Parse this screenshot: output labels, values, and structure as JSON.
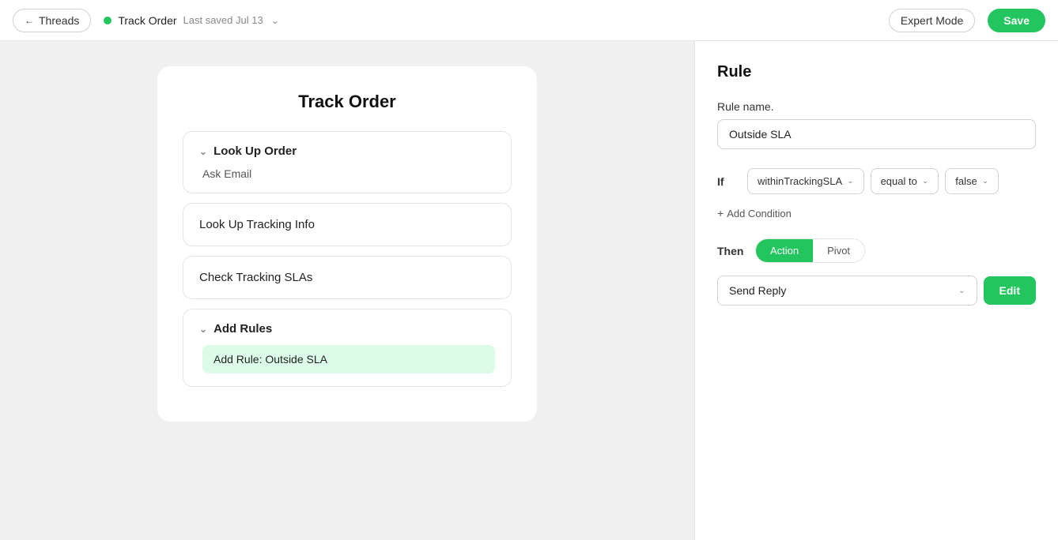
{
  "topbar": {
    "threads_label": "Threads",
    "track_order_label": "Track Order",
    "saved_label": "Last saved Jul 13",
    "expert_mode_label": "Expert Mode",
    "save_label": "Save"
  },
  "flow": {
    "title": "Track Order",
    "blocks": [
      {
        "id": "look-up-order",
        "label": "Look Up Order",
        "collapsible": true,
        "expanded": true,
        "content": "Ask Email"
      },
      {
        "id": "look-up-tracking-info",
        "label": "Look Up Tracking Info",
        "collapsible": false,
        "expanded": false,
        "content": null
      },
      {
        "id": "check-tracking-slas",
        "label": "Check Tracking SLAs",
        "collapsible": false,
        "expanded": false,
        "content": null
      },
      {
        "id": "add-rules",
        "label": "Add Rules",
        "collapsible": true,
        "expanded": true,
        "content": null,
        "highlighted_item": "Add Rule: Outside SLA"
      }
    ]
  },
  "right_panel": {
    "title": "Rule",
    "rule_name_label": "Rule name.",
    "rule_name_value": "Outside SLA",
    "rule_name_placeholder": "Outside SLA",
    "if_label": "If",
    "condition_field": "withinTrackingSLA",
    "condition_operator": "equal to",
    "condition_value": "false",
    "add_condition_label": "Add Condition",
    "then_label": "Then",
    "tab_action_label": "Action",
    "tab_pivot_label": "Pivot",
    "action_value": "Send Reply",
    "edit_label": "Edit"
  }
}
